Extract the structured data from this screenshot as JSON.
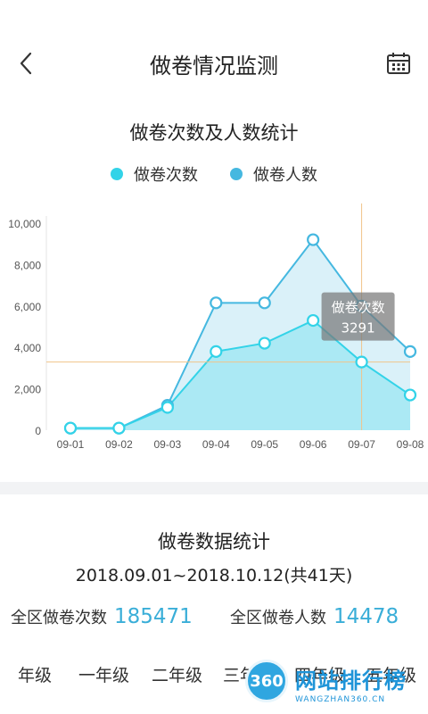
{
  "header": {
    "title": "做卷情况监测",
    "back_icon": "chevron-left-icon",
    "calendar_icon": "calendar-icon"
  },
  "chart_section": {
    "title": "做卷次数及人数统计"
  },
  "chart_data": {
    "type": "line",
    "title": "做卷次数及人数统计",
    "categories": [
      "09-01",
      "09-02",
      "09-03",
      "09-04",
      "09-05",
      "09-06",
      "09-07",
      "09-08"
    ],
    "series": [
      {
        "name": "做卷次数",
        "color": "#33d3e8",
        "values": [
          100,
          100,
          1100,
          3800,
          4200,
          5300,
          3291,
          1700
        ]
      },
      {
        "name": "做卷人数",
        "color": "#45b8e0",
        "values": [
          100,
          100,
          1200,
          6150,
          6150,
          9200,
          6000,
          3800
        ]
      }
    ],
    "ylim": [
      0,
      10000
    ],
    "yticks": [
      "0",
      "2,000",
      "4,000",
      "6,000",
      "8,000",
      "10,000"
    ],
    "legend_position": "top",
    "tooltip": {
      "series": "做卷次数",
      "value": "3291",
      "category": "09-07"
    }
  },
  "stats": {
    "title": "做卷数据统计",
    "date_range": "2018.09.01~2018.10.12(共41天)",
    "total_count_label": "全区做卷次数",
    "total_count_value": "185471",
    "total_people_label": "全区做卷人数",
    "total_people_value": "14478"
  },
  "grade_tabs": [
    "年级",
    "一年级",
    "二年级",
    "三年",
    "四年级",
    "五年级"
  ],
  "watermark": {
    "logo": "360",
    "text": "网站排行榜",
    "sub": "WANGZHAN360.CN"
  }
}
